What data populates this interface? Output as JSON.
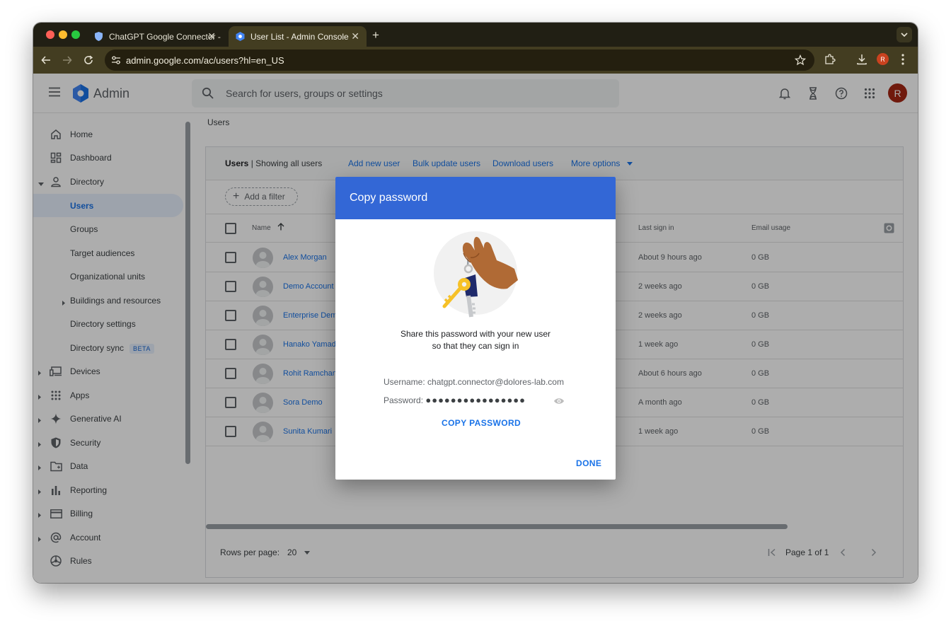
{
  "browser": {
    "tabs": [
      {
        "title": "ChatGPT Google Connector -"
      },
      {
        "title": "User List - Admin Console"
      }
    ],
    "url": "admin.google.com/ac/users?hl=en_US",
    "profile_initial": "R"
  },
  "header": {
    "app_name": "Admin",
    "search_placeholder": "Search for users, groups or settings",
    "user_initial": "R"
  },
  "sidebar": {
    "items": [
      {
        "label": "Home"
      },
      {
        "label": "Dashboard"
      },
      {
        "label": "Directory"
      },
      {
        "label": "Users"
      },
      {
        "label": "Groups"
      },
      {
        "label": "Target audiences"
      },
      {
        "label": "Organizational units"
      },
      {
        "label": "Buildings and resources"
      },
      {
        "label": "Directory settings"
      },
      {
        "label": "Directory sync",
        "badge": "BETA"
      },
      {
        "label": "Devices"
      },
      {
        "label": "Apps"
      },
      {
        "label": "Generative AI"
      },
      {
        "label": "Security"
      },
      {
        "label": "Data"
      },
      {
        "label": "Reporting"
      },
      {
        "label": "Billing"
      },
      {
        "label": "Account"
      },
      {
        "label": "Rules"
      }
    ]
  },
  "main": {
    "breadcrumb": "Users",
    "card": {
      "title_bold": "Users",
      "title_rest": " | Showing all users",
      "actions": [
        "Add new user",
        "Bulk update users",
        "Download users",
        "More options"
      ],
      "filter_label": "Add a filter",
      "columns": {
        "name": "Name",
        "last_sign_in": "Last sign in",
        "email_usage": "Email usage"
      },
      "rows": [
        {
          "name": "Alex Morgan",
          "last_sign_in": "About 9 hours ago",
          "email_usage": "0 GB"
        },
        {
          "name": "Demo Account",
          "last_sign_in": "2 weeks ago",
          "email_usage": "0 GB"
        },
        {
          "name": "Enterprise Dem",
          "last_sign_in": "2 weeks ago",
          "email_usage": "0 GB"
        },
        {
          "name": "Hanako Yamad",
          "last_sign_in": "1 week ago",
          "email_usage": "0 GB"
        },
        {
          "name": "Rohit Ramchan",
          "last_sign_in": "About 6 hours ago",
          "email_usage": "0 GB"
        },
        {
          "name": "Sora Demo",
          "last_sign_in": "A month ago",
          "email_usage": "0 GB"
        },
        {
          "name": "Sunita Kumari",
          "last_sign_in": "1 week ago",
          "email_usage": "0 GB"
        }
      ],
      "rows_per_page_label": "Rows per page:",
      "rows_per_page_value": "20",
      "page_label": "Page 1 of 1"
    }
  },
  "dialog": {
    "title": "Copy password",
    "share_line1": "Share this password with your new user",
    "share_line2": "so that they can sign in",
    "username_label": "Username:",
    "username_value": "chatgpt.connector@dolores-lab.com",
    "password_label": "Password:",
    "password_mask": "●●●●●●●●●●●●●●●●",
    "copy_button": "COPY PASSWORD",
    "done_button": "DONE"
  },
  "colors": {
    "dialog_header": "#3367d6",
    "link": "#1a73e8",
    "tab_strip": "#211f14",
    "toolbar": "#433d21"
  }
}
